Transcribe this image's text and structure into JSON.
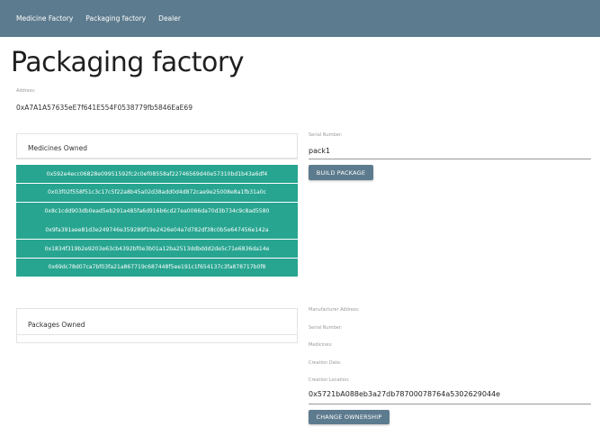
{
  "nav": {
    "items": [
      "Medicine Factory",
      "Packaging factory",
      "Dealer"
    ]
  },
  "page": {
    "title": "Packaging factory",
    "address_label": "Address:",
    "address_value": "0xA7A1A57635eE7f641E554F0538779fb5846EaE69"
  },
  "medicines": {
    "header": "Medicines Owned",
    "items": [
      "0x592e4ecc06828e09951592fc2c0ef08558af22746569d40e57310bd1b43a6df4",
      "0x03f02f558f51c3c17c5f22a8b45a02d38add0d4d872cae9e25008e8a1fb31a0c",
      "0x8c1cdd903db0ead5eb291a485fa6d916b6cd27ea0066da70d3b734c9c8ad5580",
      "0x9fa391aee81d3e249746e359289f19e2426e04a7d782df38c0b5e647456e142a",
      "0x1834f319b2e9203e63cb4392bf0e3b01a12ba2513ddbddd2de5c71e6836da14e",
      "0x69dc78d07ca7bf03fa21a867719c687448f5ee191c1f654137c3fa878717b0f8"
    ]
  },
  "packages": {
    "header": "Packages Owned"
  },
  "build": {
    "serial_label": "Serial Number:",
    "serial_value": "pack1",
    "button_label": "BUILD PACKAGE"
  },
  "details": {
    "manufacturer_label": "Manufacturer Address:",
    "serial_label": "Serial Number:",
    "medicines_label": "Medicines:",
    "creation_date_label": "Creation Date:",
    "creation_location_label": "Creation Location:",
    "creation_location_value": "0x5721bA088eb3a27db78700078764a5302629044e",
    "button_label": "CHANGE OWNERSHIP"
  },
  "colors": {
    "nav": "#5d7b8e",
    "teal": "#27a590"
  }
}
